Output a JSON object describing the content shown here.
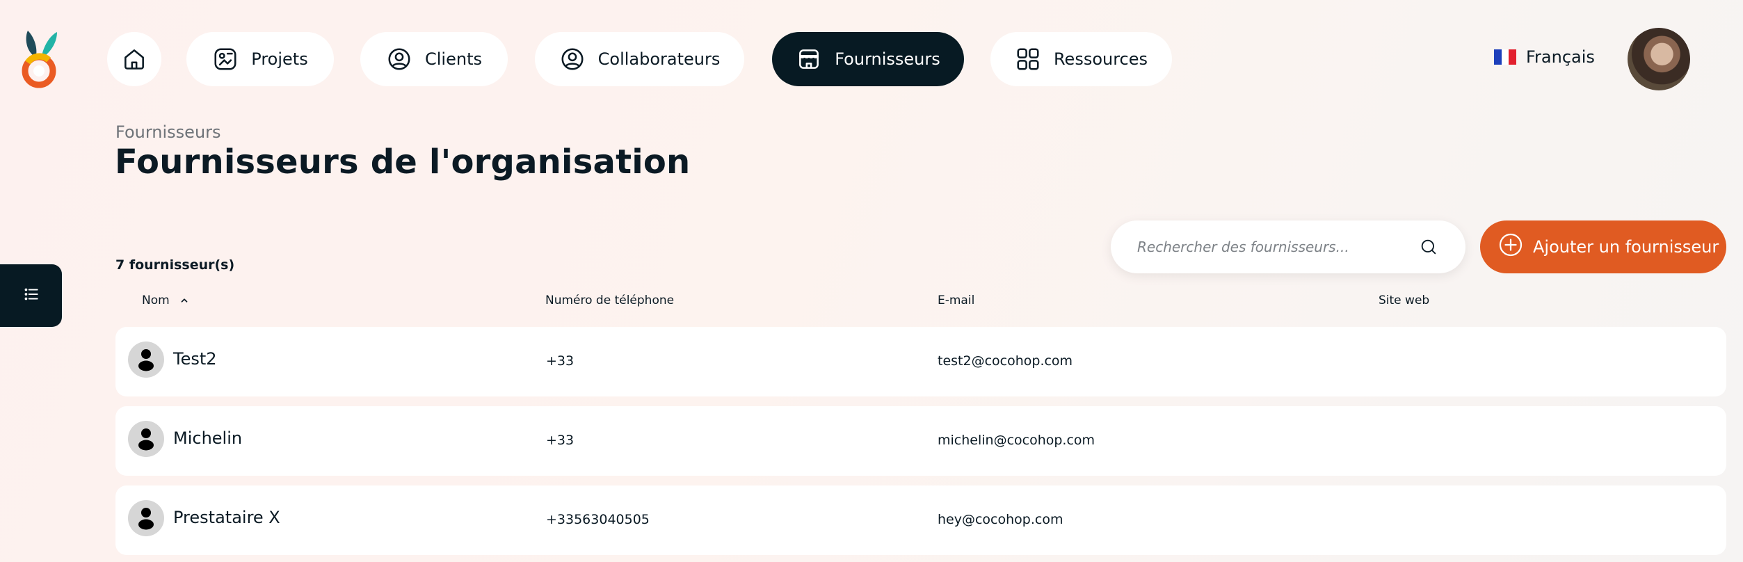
{
  "nav": {
    "items": [
      {
        "label": "",
        "icon": "home-icon"
      },
      {
        "label": "Projets",
        "icon": "projects-icon"
      },
      {
        "label": "Clients",
        "icon": "user-circle-icon"
      },
      {
        "label": "Collaborateurs",
        "icon": "user-circle-icon"
      },
      {
        "label": "Fournisseurs",
        "icon": "storefront-icon",
        "active": true
      },
      {
        "label": "Ressources",
        "icon": "grid-icon"
      }
    ]
  },
  "language": {
    "label": "Français",
    "flag": "fr-flag-icon"
  },
  "breadcrumb": "Fournisseurs",
  "page_title": "Fournisseurs de l'organisation",
  "count_label": "7 fournisseur(s)",
  "search": {
    "placeholder": "Rechercher des fournisseurs..."
  },
  "add_button": {
    "label": "Ajouter un fournisseur"
  },
  "table": {
    "columns": [
      "Nom",
      "Numéro de téléphone",
      "E-mail",
      "Site web"
    ],
    "rows": [
      {
        "name": "Test2",
        "phone": "+33",
        "email": "test2@cocohop.com",
        "website": ""
      },
      {
        "name": "Michelin",
        "phone": "+33",
        "email": "michelin@cocohop.com",
        "website": ""
      },
      {
        "name": "Prestataire X",
        "phone": "+33563040505",
        "email": "hey@cocohop.com",
        "website": ""
      }
    ]
  },
  "colors": {
    "accent": "#e05b22",
    "dark": "#071a23",
    "background": "#fdf2ef"
  }
}
